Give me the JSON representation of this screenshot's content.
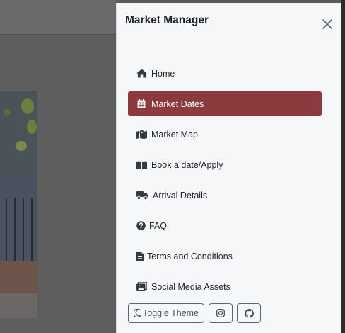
{
  "panel": {
    "title": "Market Manager",
    "close_icon": "close-icon"
  },
  "nav": {
    "items": [
      {
        "label": "Home",
        "icon": "home-icon",
        "active": false
      },
      {
        "label": "Market Dates",
        "icon": "calendar-icon",
        "active": true
      },
      {
        "label": "Market Map",
        "icon": "map-icon",
        "active": false
      },
      {
        "label": "Book a date/Apply",
        "icon": "book-icon",
        "active": false
      },
      {
        "label": "Arrival Details",
        "icon": "truck-icon",
        "active": false
      },
      {
        "label": "FAQ",
        "icon": "question-circle-icon",
        "active": false
      },
      {
        "label": "Terms and Conditions",
        "icon": "file-icon",
        "active": false
      },
      {
        "label": "Social Media Assets",
        "icon": "images-icon",
        "active": false
      }
    ]
  },
  "footer": {
    "toggle_theme_label": "Toggle Theme",
    "toggle_theme_icon": "moon-icon",
    "instagram_icon": "instagram-icon",
    "github_icon": "github-icon"
  },
  "colors": {
    "active_bg": "#8b3a3e",
    "panel_bg": "#f6f7f9",
    "overlay": "#5b5b5b"
  }
}
